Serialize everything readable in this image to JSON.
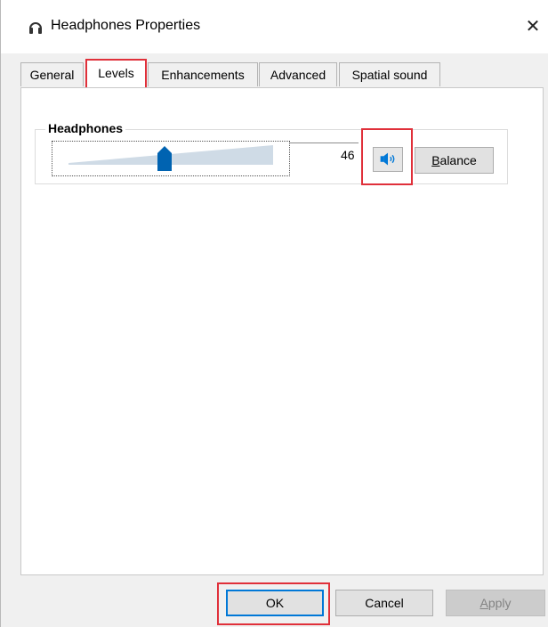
{
  "window": {
    "title": "Headphones Properties",
    "close_glyph": "✕"
  },
  "tabs": [
    {
      "label": "General"
    },
    {
      "label": "Levels",
      "active": true
    },
    {
      "label": "Enhancements"
    },
    {
      "label": "Advanced"
    },
    {
      "label": "Spatial sound"
    }
  ],
  "levels": {
    "group_label": "Headphones",
    "volume_value": "46",
    "volume_level": 46,
    "balance_label_underlined": "B",
    "balance_label_rest": "alance"
  },
  "footer": {
    "ok_label": "OK",
    "cancel_label": "Cancel",
    "apply_label_underlined": "A",
    "apply_label_rest": "pply"
  },
  "colors": {
    "accent": "#0078d7",
    "thumb": "#0063b1",
    "highlight": "#e0303a",
    "track": "#cfdbe6"
  },
  "icons": {
    "title": "headphones-icon",
    "mute": "speaker-icon",
    "close": "close-icon"
  }
}
